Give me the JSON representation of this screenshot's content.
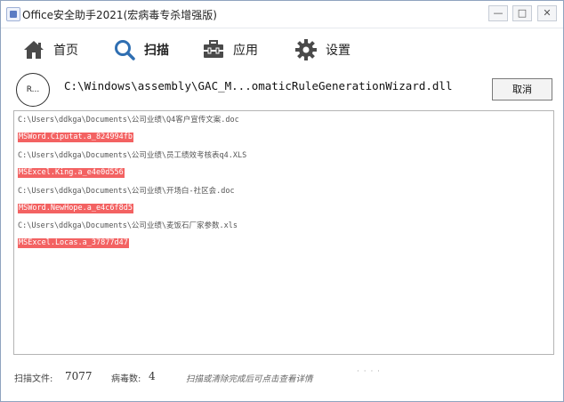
{
  "window": {
    "title": "Office安全助手2021(宏病毒专杀增强版)",
    "controls": {
      "minimize": "—",
      "maximize": "□",
      "close": "✕"
    }
  },
  "tabs": [
    {
      "label": "首页",
      "icon": "home-icon",
      "active": false
    },
    {
      "label": "扫描",
      "icon": "search-icon",
      "active": true
    },
    {
      "label": "应用",
      "icon": "toolbox-icon",
      "active": false
    },
    {
      "label": "设置",
      "icon": "gear-icon",
      "active": false
    }
  ],
  "scan": {
    "spinner_text": "R...",
    "current_file": "C:\\Windows\\assembly\\GAC_M...omaticRuleGenerationWizard.dll",
    "cancel_label": "取消"
  },
  "results": [
    {
      "path": "C:\\Users\\ddkga\\Documents\\公司业绩\\Q4客户宣传文案.doc",
      "threat": "MSWord.Ciputat.a_824994fb"
    },
    {
      "path": "C:\\Users\\ddkga\\Documents\\公司业绩\\员工绩效考核表q4.XLS",
      "threat": "MSExcel.King.a_e4e0d556"
    },
    {
      "path": "C:\\Users\\ddkga\\Documents\\公司业绩\\开场白-社区会.doc",
      "threat": "MSWord.NewHope.a_e4c6f8d5"
    },
    {
      "path": "C:\\Users\\ddkga\\Documents\\公司业绩\\麦饭石厂家参数.xls",
      "threat": "MSExcel.Locas.a_37877d47"
    }
  ],
  "footer": {
    "scanned_label": "扫描文件:",
    "scanned_count": "7077",
    "virus_label": "病毒数:",
    "virus_count": "4",
    "hint": "扫描或清除完成后可点击查看详情",
    "dots": "· · · ·"
  },
  "colors": {
    "threat_highlight": "#f36262",
    "accent": "#2f6fb2"
  }
}
